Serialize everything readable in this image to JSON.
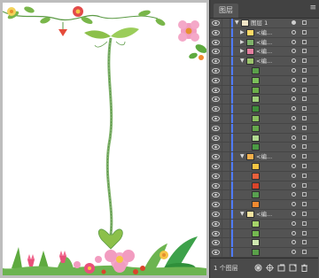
{
  "panel": {
    "tab_label": "图层",
    "menu_icon": "panel-menu-icon"
  },
  "footer": {
    "layer_count": "1 个图层"
  },
  "rows": [
    {
      "indent": 0,
      "tri": "▼",
      "name": "图层 1",
      "sel": "filled",
      "thumb": "#f2e6c8",
      "color": "#4f7bff"
    },
    {
      "indent": 1,
      "tri": "▶",
      "name": "<编...",
      "sel": "",
      "thumb": "#ffd966",
      "color": "#4f7bff"
    },
    {
      "indent": 1,
      "tri": "▶",
      "name": "<编...",
      "sel": "",
      "thumb": "#7fb26a",
      "color": "#4f7bff"
    },
    {
      "indent": 1,
      "tri": "▶",
      "name": "<编...",
      "sel": "",
      "thumb": "#e57fa0",
      "color": "#4f7bff"
    },
    {
      "indent": 1,
      "tri": "▼",
      "name": "<编...",
      "sel": "",
      "thumb": "#9bc46c",
      "color": "#4f7bff"
    },
    {
      "indent": 2,
      "tri": "",
      "name": "",
      "sel": "",
      "thumb": "#5aa04a",
      "color": "#4f7bff"
    },
    {
      "indent": 2,
      "tri": "",
      "name": "",
      "sel": "",
      "thumb": "#7bbf5a",
      "color": "#4f7bff"
    },
    {
      "indent": 2,
      "tri": "",
      "name": "",
      "sel": "",
      "thumb": "#6cae4a",
      "color": "#4f7bff"
    },
    {
      "indent": 2,
      "tri": "",
      "name": "",
      "sel": "",
      "thumb": "#9fd07a",
      "color": "#4f7bff"
    },
    {
      "indent": 2,
      "tri": "",
      "name": "",
      "sel": "",
      "thumb": "#3f8f3a",
      "color": "#4f7bff"
    },
    {
      "indent": 2,
      "tri": "",
      "name": "",
      "sel": "",
      "thumb": "#8ac060",
      "color": "#4f7bff"
    },
    {
      "indent": 2,
      "tri": "",
      "name": "",
      "sel": "",
      "thumb": "#66a84c",
      "color": "#4f7bff"
    },
    {
      "indent": 2,
      "tri": "",
      "name": "",
      "sel": "",
      "thumb": "#b0d890",
      "color": "#4f7bff"
    },
    {
      "indent": 2,
      "tri": "",
      "name": "",
      "sel": "",
      "thumb": "#4c9a44",
      "color": "#4f7bff"
    },
    {
      "indent": 1,
      "tri": "▼",
      "name": "<编...",
      "sel": "",
      "thumb": "#f6b04a",
      "color": "#4f7bff"
    },
    {
      "indent": 2,
      "tri": "",
      "name": "",
      "sel": "",
      "thumb": "#f4c542",
      "color": "#4f7bff"
    },
    {
      "indent": 2,
      "tri": "",
      "name": "",
      "sel": "",
      "thumb": "#e8603c",
      "color": "#4f7bff"
    },
    {
      "indent": 2,
      "tri": "",
      "name": "",
      "sel": "",
      "thumb": "#d9442b",
      "color": "#4f7bff"
    },
    {
      "indent": 2,
      "tri": "",
      "name": "",
      "sel": "",
      "thumb": "#59a050",
      "color": "#4f7bff"
    },
    {
      "indent": 2,
      "tri": "",
      "name": "",
      "sel": "",
      "thumb": "#f08a30",
      "color": "#4f7bff"
    },
    {
      "indent": 1,
      "tri": "▼",
      "name": "<编...",
      "sel": "",
      "thumb": "#f3e3a0",
      "color": "#4f7bff"
    },
    {
      "indent": 2,
      "tri": "",
      "name": "",
      "sel": "",
      "thumb": "#a6d46a",
      "color": "#4f7bff"
    },
    {
      "indent": 2,
      "tri": "",
      "name": "",
      "sel": "",
      "thumb": "#74b850",
      "color": "#4f7bff"
    },
    {
      "indent": 2,
      "tri": "",
      "name": "",
      "sel": "",
      "thumb": "#cfe8b0",
      "color": "#4f7bff"
    },
    {
      "indent": 2,
      "tri": "",
      "name": "",
      "sel": "",
      "thumb": "#5aa04a",
      "color": "#4f7bff"
    }
  ],
  "footer_icons": [
    "make-clipping-mask-icon",
    "new-sublayer-icon",
    "new-layer-icon",
    "delete-layer-icon",
    "locate-object-icon"
  ],
  "colors": {
    "panel_bg": "#535353",
    "layer_color": "#4f7bff",
    "artboard": "#ffffff"
  }
}
